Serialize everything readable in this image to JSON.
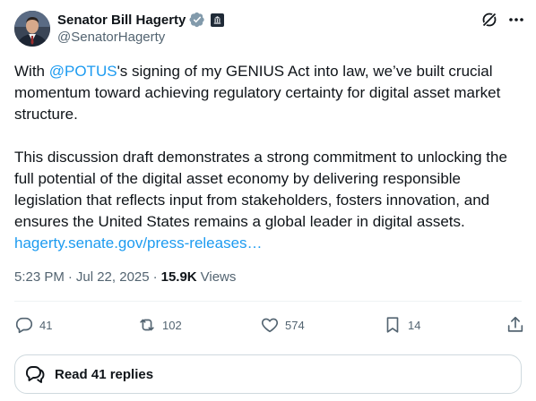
{
  "author": {
    "display_name": "Senator Bill Hagerty",
    "handle": "@SenatorHagerty",
    "verified_badge_icon": "verified-badge-icon",
    "affiliation_badge_icon": "government-badge-icon"
  },
  "tweet": {
    "para1": {
      "before_mention": "With ",
      "mention": "@POTUS",
      "after_mention": "'s signing of my GENIUS Act into law, we’ve built crucial momentum toward achieving regulatory certainty for digital asset market structure."
    },
    "para2": {
      "text": "This discussion draft demonstrates a strong commitment to unlocking the full potential of the digital asset economy by delivering responsible legislation that reflects input from stakeholders, fosters innovation, and ensures the United States remains a global leader in digital assets.",
      "link": "hagerty.senate.gov/press-releases…"
    }
  },
  "meta": {
    "time": "5:23 PM",
    "separator": "·",
    "date": "Jul 22, 2025",
    "views_count": "15.9K",
    "views_label": "Views"
  },
  "actions": {
    "replies": "41",
    "reposts": "102",
    "likes": "574",
    "bookmarks": "14"
  },
  "read_replies": "Read 41 replies",
  "colors": {
    "accent": "#1d9bf0",
    "text": "#0f1419",
    "muted": "#536471",
    "border": "#cfd9de",
    "verified": "#829aab"
  }
}
